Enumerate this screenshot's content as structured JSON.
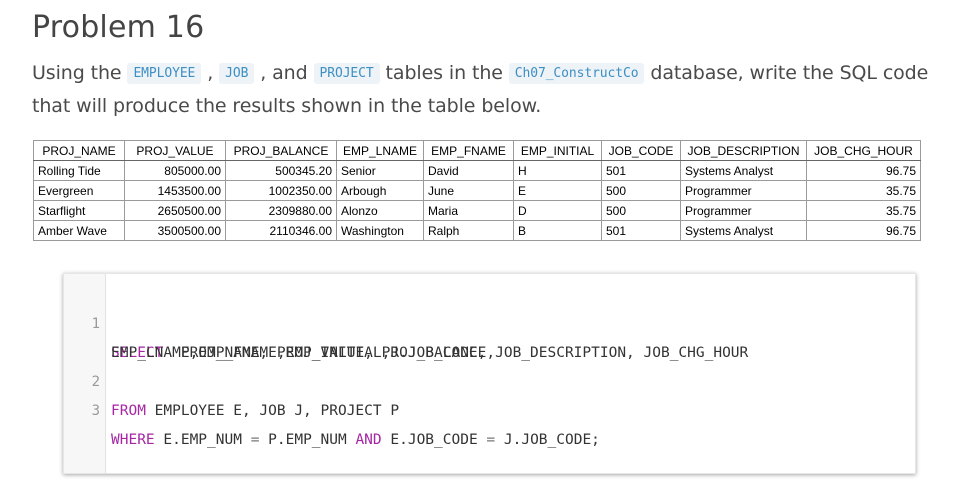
{
  "heading": "Problem 16",
  "description": {
    "part1": "Using the ",
    "code1": "EMPLOYEE",
    "sep1": " , ",
    "code2": "JOB",
    "part2": " , and ",
    "code3": "PROJECT",
    "part3": " tables in the ",
    "code4": "Ch07_ConstructCo",
    "part4": " database, write the SQL code that will produce the results shown in the table below."
  },
  "result_table": {
    "columns": [
      "PROJ_NAME",
      "PROJ_VALUE",
      "PROJ_BALANCE",
      "EMP_LNAME",
      "EMP_FNAME",
      "EMP_INITIAL",
      "JOB_CODE",
      "JOB_DESCRIPTION",
      "JOB_CHG_HOUR"
    ],
    "rows": [
      [
        "Rolling Tide",
        "805000.00",
        "500345.20",
        "Senior",
        "David",
        "H",
        "501",
        "Systems Analyst",
        "96.75"
      ],
      [
        "Evergreen",
        "1453500.00",
        "1002350.00",
        "Arbough",
        "June",
        "E",
        "500",
        "Programmer",
        "35.75"
      ],
      [
        "Starflight",
        "2650500.00",
        "2309880.00",
        "Alonzo",
        "Maria",
        "D",
        "500",
        "Programmer",
        "35.75"
      ],
      [
        "Amber Wave",
        "3500500.00",
        "2110346.00",
        "Washington",
        "Ralph",
        "B",
        "501",
        "Systems Analyst",
        "96.75"
      ]
    ]
  },
  "code": {
    "line1_num": "1",
    "line1_kw": "SELECT",
    "line1_rest": "  PROJ_NAME, PROJ_VALUE, PROJ_BALANCE,",
    "line1b_rest": "EMP_LNAME,EMP_FNAME,EMP_INITIAL,J.JOB_CODE, JOB_DESCRIPTION, JOB_CHG_HOUR",
    "line2_num": "2",
    "line2_kw": "FROM",
    "line2_rest": " EMPLOYEE E, JOB J, PROJECT P",
    "line3_num": "3",
    "line3_kw1": "WHERE",
    "line3_a": " E.EMP_NUM ",
    "line3_eq1": "=",
    "line3_b": " P.EMP_NUM ",
    "line3_kw2": "AND",
    "line3_c": " E.JOB_CODE ",
    "line3_eq2": "=",
    "line3_d": " J.JOB_CODE;"
  },
  "colors": {
    "keyword": "#a626a4",
    "inline_code": "#3d8fc4",
    "heading": "#444444"
  }
}
